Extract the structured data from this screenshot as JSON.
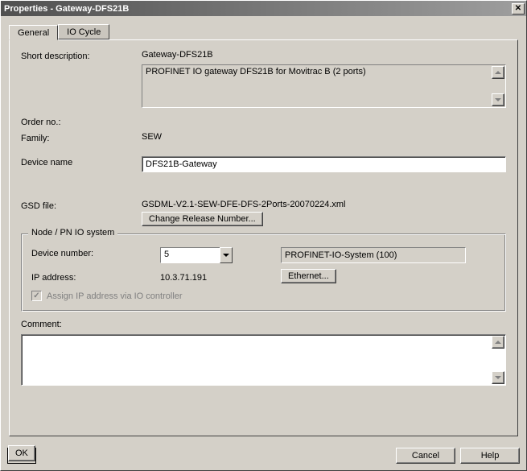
{
  "window": {
    "title": "Properties - Gateway-DFS21B"
  },
  "tabs": {
    "general": "General",
    "io_cycle": "IO Cycle"
  },
  "general": {
    "short_desc_label": "Short description:",
    "short_desc_value": "Gateway-DFS21B",
    "long_desc_text": "PROFINET IO gateway DFS21B for Movitrac B (2 ports)",
    "order_no_label": "Order no.:",
    "family_label": "Family:",
    "family_value": "SEW",
    "device_name_label": "Device name",
    "device_name_value": "DFS21B-Gateway",
    "gsd_file_label": "GSD file:",
    "gsd_file_value": "GSDML-V2.1-SEW-DFE-DFS-2Ports-20070224.xml",
    "change_release_btn": "Change Release Number..."
  },
  "node": {
    "legend": "Node / PN IO system",
    "device_number_label": "Device number:",
    "device_number_value": "5",
    "system_value": "PROFINET-IO-System (100)",
    "ip_label": "IP address:",
    "ip_value": "10.3.71.191",
    "ethernet_btn": "Ethernet...",
    "assign_ip_label": "Assign IP address via IO controller"
  },
  "comment": {
    "label": "Comment:"
  },
  "buttons": {
    "ok": "OK",
    "cancel": "Cancel",
    "help": "Help"
  },
  "glyphs": {
    "close": "✕",
    "check": "✓"
  }
}
